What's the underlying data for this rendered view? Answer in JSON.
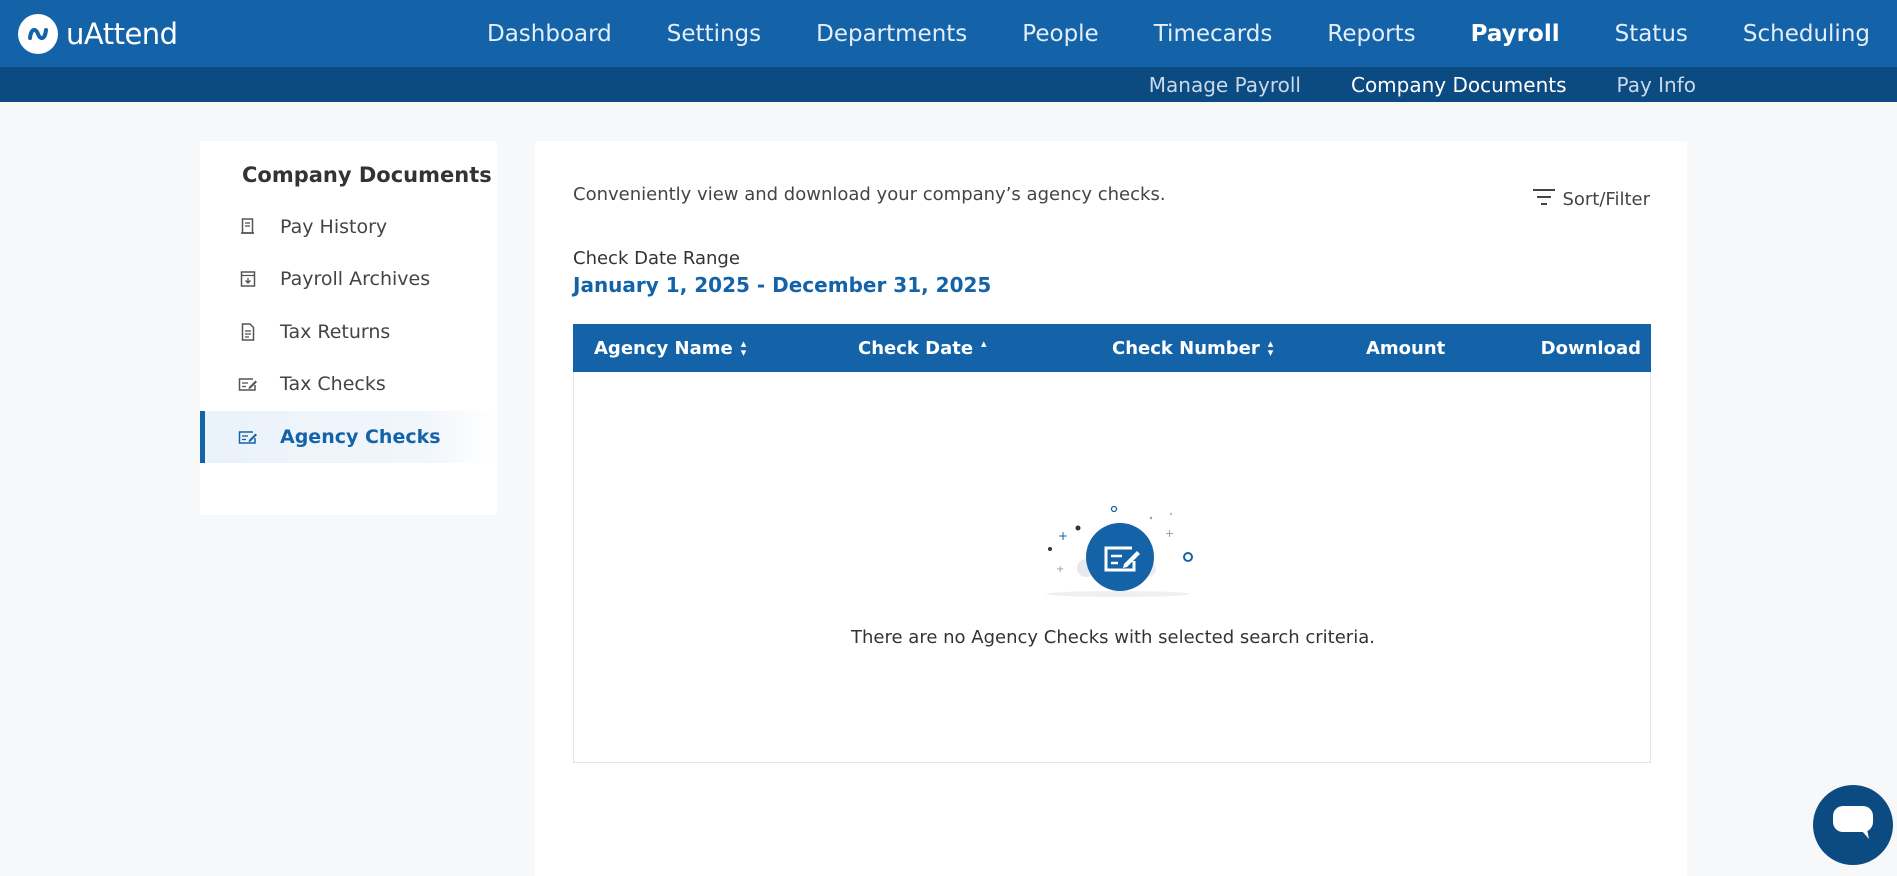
{
  "app": {
    "name": "uAttend"
  },
  "nav": {
    "items": [
      {
        "label": "Dashboard"
      },
      {
        "label": "Settings"
      },
      {
        "label": "Departments"
      },
      {
        "label": "People"
      },
      {
        "label": "Timecards"
      },
      {
        "label": "Reports"
      },
      {
        "label": "Payroll"
      },
      {
        "label": "Status"
      },
      {
        "label": "Scheduling"
      }
    ],
    "active": "Payroll"
  },
  "subnav": {
    "items": [
      {
        "label": "Manage Payroll"
      },
      {
        "label": "Company Documents"
      },
      {
        "label": "Pay Info"
      }
    ],
    "active": "Company Documents"
  },
  "sidebar": {
    "title": "Company Documents",
    "items": [
      {
        "label": "Pay History",
        "icon": "receipt-icon"
      },
      {
        "label": "Payroll Archives",
        "icon": "archive-icon"
      },
      {
        "label": "Tax Returns",
        "icon": "document-icon"
      },
      {
        "label": "Tax Checks",
        "icon": "check-icon"
      },
      {
        "label": "Agency Checks",
        "icon": "check-icon"
      }
    ],
    "active": "Agency Checks"
  },
  "main": {
    "intro": "Conveniently view and download your company’s agency checks.",
    "sort_filter_label": "Sort/Filter",
    "range_label": "Check Date Range",
    "range_value": "January 1, 2025 - December 31, 2025",
    "table": {
      "columns": [
        {
          "label": "Agency Name",
          "sort": "both"
        },
        {
          "label": "Check Date",
          "sort": "asc"
        },
        {
          "label": "Check Number",
          "sort": "both"
        },
        {
          "label": "Amount",
          "sort": "none"
        },
        {
          "label": "Download",
          "sort": "none"
        }
      ],
      "rows": [],
      "empty_message": "There are no Agency Checks with selected search criteria."
    }
  },
  "colors": {
    "brand": "#1463a8",
    "brand_dark": "#0c4a82",
    "background": "#f7f8fa"
  }
}
